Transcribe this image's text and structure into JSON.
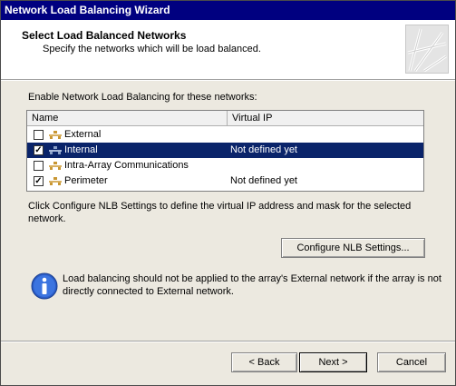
{
  "window": {
    "title": "Network Load Balancing Wizard"
  },
  "header": {
    "title": "Select Load Balanced Networks",
    "subtitle": "Specify the networks which will be load balanced."
  },
  "main": {
    "enable_label": "Enable Network Load Balancing for these networks:",
    "columns": [
      "Name",
      "Virtual IP"
    ],
    "networks": [
      {
        "name": "External",
        "virtual_ip": "",
        "checked": false,
        "selected": false
      },
      {
        "name": "Internal",
        "virtual_ip": "Not defined yet",
        "checked": true,
        "selected": true
      },
      {
        "name": "Intra-Array Communications",
        "virtual_ip": "",
        "checked": false,
        "selected": false
      },
      {
        "name": "Perimeter",
        "virtual_ip": "Not defined yet",
        "checked": true,
        "selected": false
      }
    ],
    "configure_hint": "Click Configure NLB Settings to define the virtual IP address and mask for the selected network.",
    "configure_button": "Configure NLB Settings...",
    "info_text": "Load balancing should not be applied to the array's External network if the array is not directly connected to External network."
  },
  "footer": {
    "back_label": "< Back",
    "next_label": "Next >",
    "cancel_label": "Cancel"
  },
  "colors": {
    "titlebar": "#000080",
    "selection": "#0a246a"
  }
}
